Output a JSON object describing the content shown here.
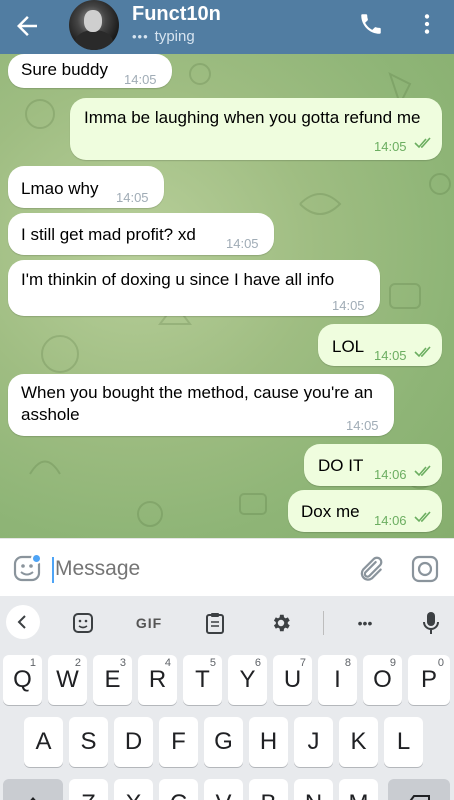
{
  "header": {
    "title": "Funct10n",
    "status": "typing",
    "status_dots": "•••"
  },
  "messages": [
    {
      "side": "in",
      "text": "Sure buddy",
      "time": "14:05"
    },
    {
      "side": "out",
      "text": "Imma be laughing when you gotta refund me",
      "time": "14:05",
      "read": true
    },
    {
      "side": "in",
      "text": "Lmao why",
      "time": "14:05"
    },
    {
      "side": "in",
      "text": "I still get mad profit? xd",
      "time": "14:05"
    },
    {
      "side": "in",
      "text": "I'm thinkin of doxing u since I have all info",
      "time": "14:05"
    },
    {
      "side": "out",
      "text": "LOL",
      "time": "14:05",
      "read": true
    },
    {
      "side": "in",
      "text": "When you bought the method, cause you're an asshole",
      "time": "14:05"
    },
    {
      "side": "out",
      "text": "DO IT",
      "time": "14:06",
      "read": true
    },
    {
      "side": "out",
      "text": "Dox me",
      "time": "14:06",
      "read": true
    }
  ],
  "composer": {
    "placeholder": "Message"
  },
  "keyboard": {
    "toolbar": {
      "gif_label": "GIF",
      "more_label": "•••"
    },
    "row1": [
      {
        "k": "Q",
        "n": "1"
      },
      {
        "k": "W",
        "n": "2"
      },
      {
        "k": "E",
        "n": "3"
      },
      {
        "k": "R",
        "n": "4"
      },
      {
        "k": "T",
        "n": "5"
      },
      {
        "k": "Y",
        "n": "6"
      },
      {
        "k": "U",
        "n": "7"
      },
      {
        "k": "I",
        "n": "8"
      },
      {
        "k": "O",
        "n": "9"
      },
      {
        "k": "P",
        "n": "0"
      }
    ],
    "row2": [
      "A",
      "S",
      "D",
      "F",
      "G",
      "H",
      "J",
      "K",
      "L"
    ],
    "row3": [
      "Z",
      "X",
      "C",
      "V",
      "B",
      "N",
      "M"
    ]
  },
  "colors": {
    "header": "#517da2",
    "incoming_bubble": "#ffffff",
    "outgoing_bubble": "#effdde",
    "outgoing_time": "#6cae61",
    "accent": "#4ea4f6"
  }
}
